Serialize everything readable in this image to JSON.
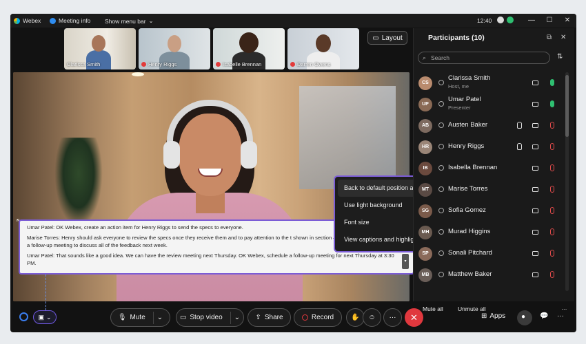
{
  "titlebar": {
    "app_name": "Webex",
    "meeting_info": "Meeting info",
    "show_menu_bar": "Show menu bar",
    "time": "12:40"
  },
  "thumbnails": [
    {
      "name": "Clarissa Smith",
      "muted": false
    },
    {
      "name": "Henry Riggs",
      "muted": true
    },
    {
      "name": "Isabelle Brennan",
      "muted": true
    },
    {
      "name": "Darren Owens",
      "muted": true
    }
  ],
  "layout_button": "Layout",
  "captions": [
    "Umar Patel: OK Webex, create an action item for Henry Riggs to send the specs to everyone.",
    "Marise Torres: Henry should ask everyone to review the specs once they receive them and to pay attention to the t shown in section 4.0. Then we should have a follow-up meeting to discuss all of the feedback next week.",
    "Umar Patel: That sounds like a good idea. We can have the review meeting next Thursday. OK Webex, schedule a follow-up meeting for next Thursday at 3:30 PM."
  ],
  "context_menu": {
    "items": [
      "Back to default position and size",
      "Use light background",
      "Font size",
      "View captions and highlights"
    ]
  },
  "participants": {
    "title": "Participants (10)",
    "search_placeholder": "Search",
    "list": [
      {
        "name": "Clarissa Smith",
        "role": "Host, me",
        "mic": "on",
        "hand": false,
        "initials": "CS",
        "color": "#b98b6e"
      },
      {
        "name": "Umar Patel",
        "role": "Presenter",
        "mic": "on",
        "hand": false,
        "initials": "UP",
        "color": "#8a6a55"
      },
      {
        "name": "Austen Baker",
        "role": "",
        "mic": "off",
        "hand": true,
        "initials": "AB",
        "color": "#7e6b60"
      },
      {
        "name": "Henry Riggs",
        "role": "",
        "mic": "off",
        "hand": true,
        "initials": "HR",
        "color": "#9a8577"
      },
      {
        "name": "Isabella Brennan",
        "role": "",
        "mic": "off",
        "hand": false,
        "initials": "IB",
        "color": "#6b4a3e"
      },
      {
        "name": "Marise Torres",
        "role": "",
        "mic": "off",
        "hand": false,
        "initials": "MT",
        "color": "#5a4a44"
      },
      {
        "name": "Sofia Gomez",
        "role": "",
        "mic": "off",
        "hand": false,
        "initials": "SG",
        "color": "#7a5a4a"
      },
      {
        "name": "Murad Higgins",
        "role": "",
        "mic": "off",
        "hand": false,
        "initials": "MH",
        "color": "#6a5a50"
      },
      {
        "name": "Sonali Pitchard",
        "role": "",
        "mic": "off",
        "hand": false,
        "initials": "SP",
        "color": "#8a6a5a"
      },
      {
        "name": "Matthew Baker",
        "role": "",
        "mic": "off",
        "hand": false,
        "initials": "MB",
        "color": "#6a5e58"
      }
    ],
    "mute_all": "Mute all",
    "unmute_all": "Unmute all"
  },
  "controls": {
    "mute": "Mute",
    "stop_video": "Stop video",
    "share": "Share",
    "record": "Record",
    "apps": "Apps"
  }
}
